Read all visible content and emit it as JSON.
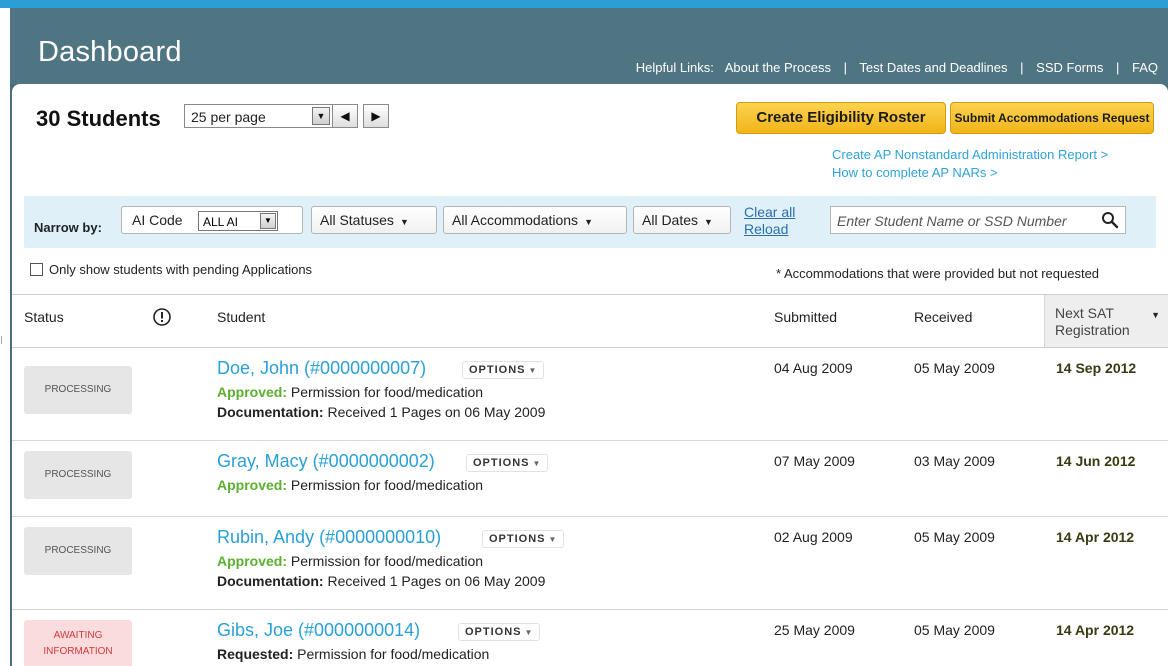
{
  "header": {
    "title": "Dashboard",
    "helpful_label": "Helpful Links:",
    "links": [
      "About the Process",
      "Test Dates and Deadlines",
      "SSD Forms",
      "FAQ"
    ],
    "separator": "|"
  },
  "toolbar": {
    "count": "30 Students",
    "per_page": "25 per page",
    "prev_label": "◀",
    "next_label": "▶",
    "create_roster": "Create Eligibility Roster",
    "submit_request": "Submit Accommodations Request",
    "ap_report_link": "Create AP Nonstandard Administration Report >",
    "ap_how_link": "How to complete AP NARs >"
  },
  "filters": {
    "narrow_by": "Narrow by:",
    "ai_code_label": "AI Code",
    "ai_code_value": "ALL AI",
    "statuses": "All Statuses",
    "accommodations": "All Accommodations",
    "dates": "All Dates",
    "clear_all": "Clear all",
    "reload": "Reload",
    "search_placeholder": "Enter Student Name or SSD Number",
    "pending_checkbox": "Only show students with pending Applications",
    "note": "* Accommodations that were provided but not requested"
  },
  "table": {
    "headers": {
      "status": "Status",
      "student": "Student",
      "submitted": "Submitted",
      "received": "Received",
      "next_sat_line1": "Next SAT",
      "next_sat_line2": "Registration"
    },
    "options_label": "OPTIONS",
    "rows": [
      {
        "status": "PROCESSING",
        "name": "Doe, John (#0000000007)",
        "decision_label": "Approved:",
        "decision_text": " Permission for food/medication",
        "doc_label": "Documentation:",
        "doc_text": " Received 1 Pages on 06 May 2009",
        "submitted": "04 Aug 2009",
        "received": "05 May 2009",
        "next": "14 Sep 2012"
      },
      {
        "status": "PROCESSING",
        "name": "Gray, Macy (#0000000002)",
        "decision_label": "Approved:",
        "decision_text": " Permission for food/medication",
        "submitted": "07 May 2009",
        "received": "03 May 2009",
        "next": "14 Jun 2012"
      },
      {
        "status": "PROCESSING",
        "name": "Rubin, Andy (#0000000010)",
        "decision_label": "Approved:",
        "decision_text": " Permission for food/medication",
        "doc_label": "Documentation:",
        "doc_text": " Received 1 Pages on 06 May 2009",
        "submitted": "02 Aug 2009",
        "received": "05 May 2009",
        "next": "14 Apr 2012"
      },
      {
        "status_line1": "AWAITING",
        "status_line2": "INFORMATION",
        "name": "Gibs, Joe (#0000000014)",
        "decision_label": "Requested:",
        "decision_text": " Permission for food/medication",
        "submitted": "25 May 2009",
        "received": "05 May 2009",
        "next": "14 Apr 2012"
      }
    ]
  },
  "colors": {
    "header_bg": "#4f7583",
    "top_strip": "#2a9fd6",
    "link_blue": "#2fa2d8",
    "approved_green": "#5bb030",
    "button_yellow": "#f7c32e",
    "awaiting_red": "#d3383e"
  }
}
